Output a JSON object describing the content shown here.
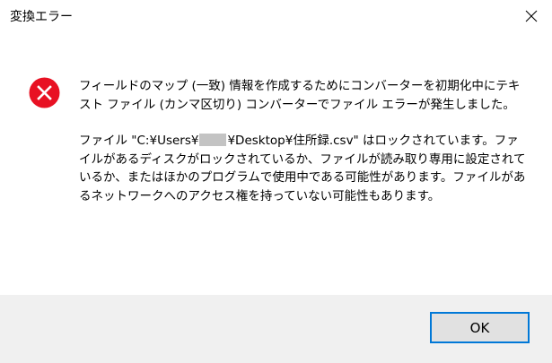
{
  "window": {
    "title": "変換エラー",
    "close_icon": "close-icon"
  },
  "message": {
    "icon": "error-icon",
    "line1": "フィールドのマップ (一致) 情報を作成するためにコンバーターを初期化中にテキスト ファイル (カンマ区切り) コンバーターでファイル エラーが発生しました。",
    "path_prefix": "ファイル \"C:¥Users¥",
    "path_suffix": "¥Desktop¥住所録.csv\" はロックされています。ファイルがあるディスクがロックされているか、ファイルが読み取り専用に設定されているか、またはほかのプログラムで使用中である可能性があります。ファイルがあるネットワークへのアクセス権を持っていない可能性もあります。"
  },
  "buttons": {
    "ok_label": "OK"
  },
  "colors": {
    "error_red": "#e81123",
    "focus_border": "#0078d7",
    "footer_bg": "#f0f0f0",
    "button_bg": "#e1e1e1"
  }
}
